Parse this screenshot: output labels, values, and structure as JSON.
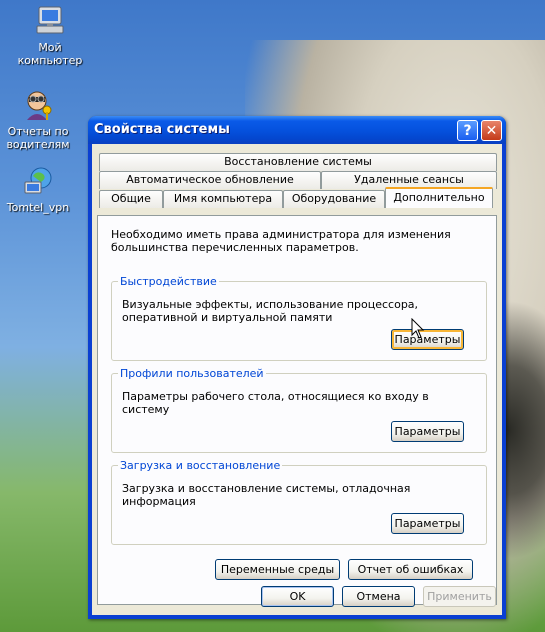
{
  "desktop": {
    "icons": [
      {
        "label": "Мой компьютер",
        "icon": "my-computer-icon"
      },
      {
        "label": "Отчеты по водителям",
        "icon": "reports-icon"
      },
      {
        "label": "Tomtel_vpn",
        "icon": "network-icon"
      }
    ]
  },
  "window": {
    "title": "Свойства системы",
    "help_button": "?",
    "close_button": "✕",
    "tabs_row1": [
      "Восстановление системы"
    ],
    "tabs_row2": [
      "Автоматическое обновление",
      "Удаленные сеансы"
    ],
    "tabs_row3": [
      "Общие",
      "Имя компьютера",
      "Оборудование",
      "Дополнительно"
    ],
    "active_tab": "Дополнительно",
    "intro": "Необходимо иметь права администратора для изменения большинства перечисленных параметров.",
    "groups": [
      {
        "title": "Быстродействие",
        "desc": "Визуальные эффекты, использование процессора, оперативной и виртуальной памяти",
        "button": "Параметры"
      },
      {
        "title": "Профили пользователей",
        "desc": "Параметры рабочего стола, относящиеся ко входу в систему",
        "button": "Параметры"
      },
      {
        "title": "Загрузка и восстановление",
        "desc": "Загрузка и восстановление системы, отладочная информация",
        "button": "Параметры"
      }
    ],
    "env_button": "Переменные среды",
    "error_button": "Отчет об ошибках",
    "ok_button": "OK",
    "cancel_button": "Отмена",
    "apply_button": "Применить"
  }
}
